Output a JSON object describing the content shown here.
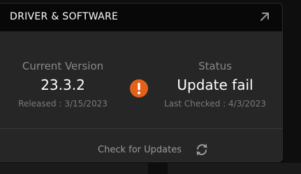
{
  "card": {
    "title": "DRIVER & SOFTWARE",
    "expand_icon": "expand-arrow-icon"
  },
  "current_version": {
    "label": "Current Version",
    "value": "23.3.2",
    "released": "Released : 3/15/2023"
  },
  "alert": {
    "icon": "exclamation-circle-icon",
    "color": "#e2621b"
  },
  "status": {
    "label": "Status",
    "value": "Update fail",
    "last_checked": "Last Checked : 4/3/2023"
  },
  "actions": {
    "check_label": "Check for Updates",
    "refresh_icon": "refresh-icon"
  }
}
